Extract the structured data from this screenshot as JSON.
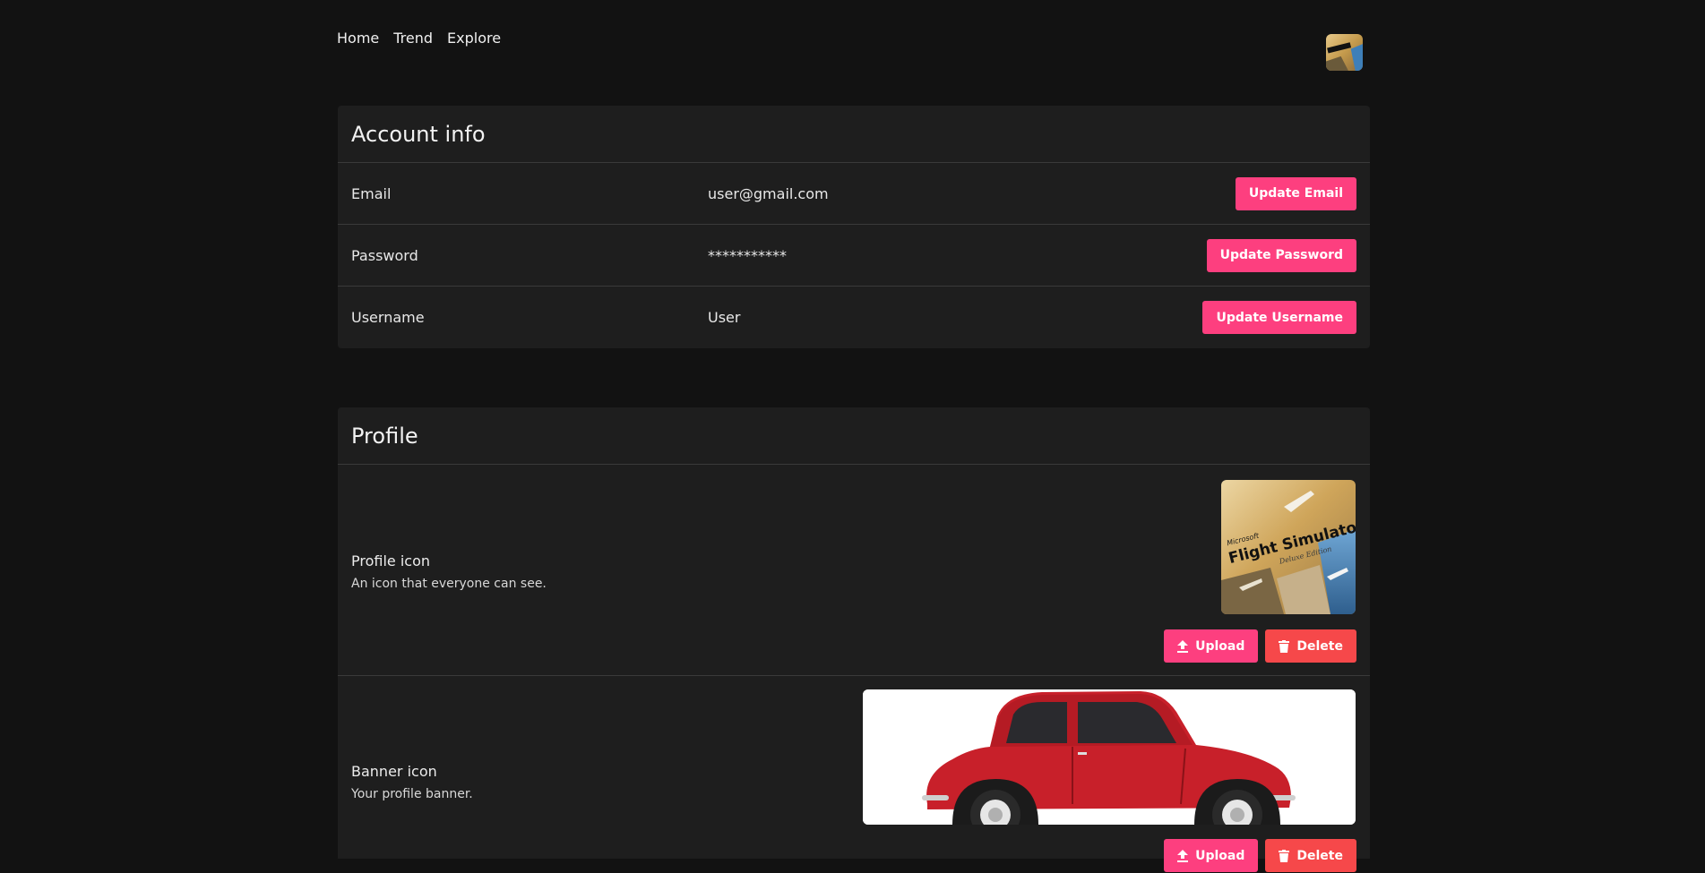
{
  "nav": {
    "items": [
      "Home",
      "Trend",
      "Explore"
    ]
  },
  "account": {
    "title": "Account info",
    "rows": [
      {
        "label": "Email",
        "value": "user@gmail.com",
        "button": "Update Email"
      },
      {
        "label": "Password",
        "value": "***********",
        "button": "Update Password"
      },
      {
        "label": "Username",
        "value": "User",
        "button": "Update Username"
      }
    ]
  },
  "profile": {
    "title": "Profile",
    "icon_row": {
      "label": "Profile icon",
      "description": "An icon that everyone can see.",
      "upload_label": "Upload",
      "delete_label": "Delete",
      "image_text": {
        "brand": "Microsoft",
        "title": "Flight Simulator",
        "edition": "Deluxe Edition"
      }
    },
    "banner_row": {
      "label": "Banner icon",
      "description": "Your profile banner.",
      "upload_label": "Upload",
      "delete_label": "Delete"
    }
  },
  "colors": {
    "accent": "#fd3f7f",
    "danger": "#f6484a",
    "background": "#121212",
    "card": "#1e1e1e"
  },
  "icons": {
    "upload": "upload-icon",
    "delete": "trash-icon"
  }
}
